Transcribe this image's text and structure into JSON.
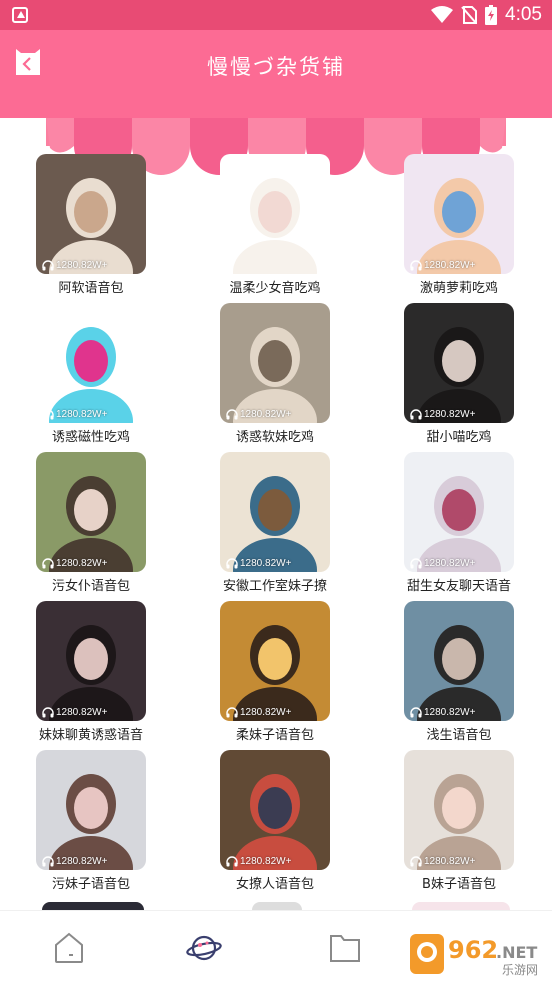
{
  "status_bar": {
    "time": "4:05"
  },
  "header": {
    "title": "慢慢づ杂货铺"
  },
  "accent": "#fc6b94",
  "items": [
    {
      "name": "阿软语音包",
      "plays": "1280.82W+"
    },
    {
      "name": "温柔少女音吃鸡",
      "plays": ""
    },
    {
      "name": "激萌萝莉吃鸡",
      "plays": "1280.82W+"
    },
    {
      "name": "诱惑磁性吃鸡",
      "plays": "1280.82W+"
    },
    {
      "name": "诱惑软妹吃鸡",
      "plays": "1280.82W+"
    },
    {
      "name": "甜小喵吃鸡",
      "plays": "1280.82W+"
    },
    {
      "name": "污女仆语音包",
      "plays": "1280.82W+"
    },
    {
      "name": "安徽工作室妹子撩",
      "plays": "1280.82W+"
    },
    {
      "name": "甜生女友聊天语音",
      "plays": "1280.82W+"
    },
    {
      "name": "妹妹聊黄诱惑语音",
      "plays": "1280.82W+"
    },
    {
      "name": "柔妹子语音包",
      "plays": "1280.82W+"
    },
    {
      "name": "浅生语音包",
      "plays": "1280.82W+"
    },
    {
      "name": "污妹子语音包",
      "plays": "1280.82W+"
    },
    {
      "name": "女撩人语音包",
      "plays": "1280.82W+"
    },
    {
      "name": "B妹子语音包",
      "plays": "1280.82W+"
    }
  ],
  "bottom_nav": [
    "home-icon",
    "planet-icon",
    "folder-icon"
  ],
  "watermark": {
    "number": "962",
    "suffix": ".NET",
    "subtitle": "乐游网"
  }
}
